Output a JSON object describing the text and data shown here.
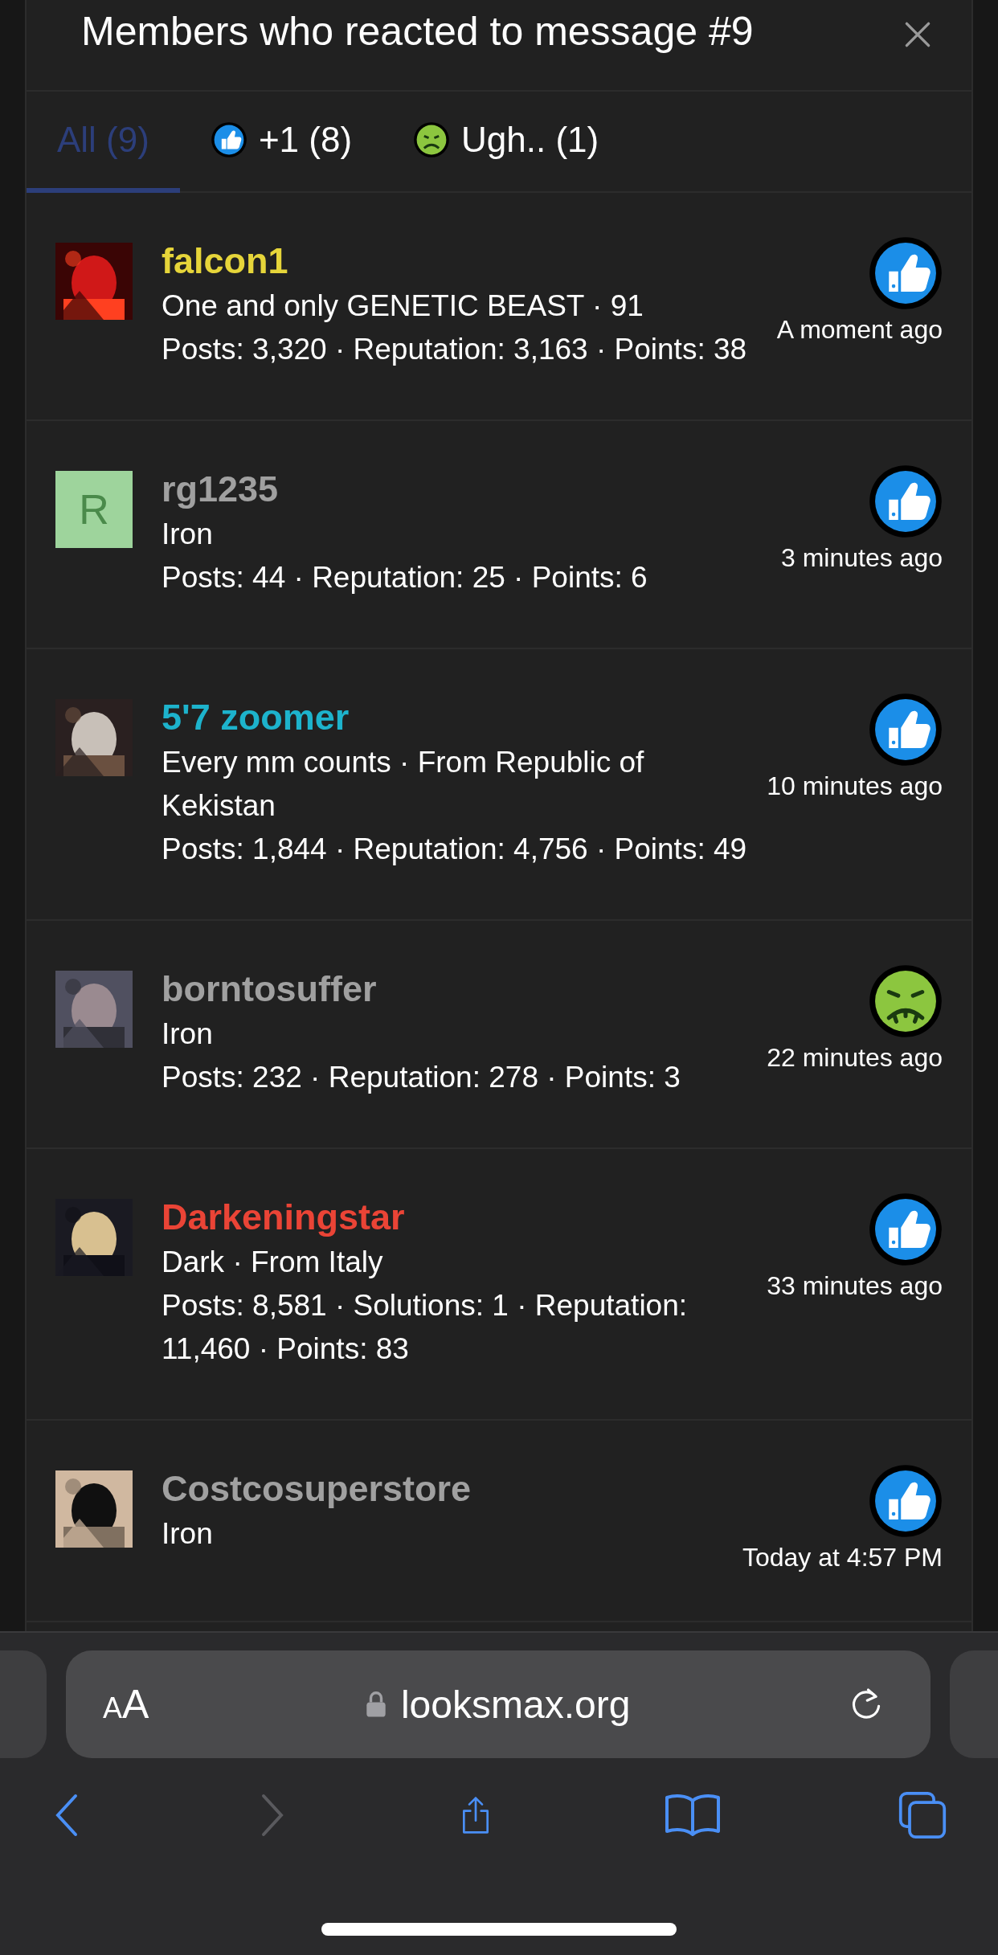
{
  "dialog": {
    "title": "Members who reacted to message #9"
  },
  "tabs": [
    {
      "label": "All (9)",
      "kind": "all",
      "selected": true
    },
    {
      "label": "+1 (8)",
      "kind": "like",
      "selected": false
    },
    {
      "label": "Ugh.. (1)",
      "kind": "ugh",
      "selected": false
    }
  ],
  "members": [
    {
      "name": "falcon1",
      "color": "#e6d53a",
      "details": "One and only GENETIC BEAST · 91",
      "stats": "Posts: 3,320 · Reputation: 3,163 · Points: 38",
      "reaction": {
        "kind": "like"
      },
      "time": "A moment ago"
    },
    {
      "name": "rg1235",
      "color": "#a0a0a0",
      "avatar": {
        "kind": "letter",
        "letter": "R"
      },
      "details": "Iron",
      "stats": "Posts: 44 · Reputation: 25 · Points: 6",
      "reaction": {
        "kind": "like"
      },
      "time": "3 minutes ago"
    },
    {
      "name": "5'7 zoomer",
      "color": "#1db3cc",
      "details": "Every mm counts · From Republic of Kekistan",
      "stats": "Posts: 1,844 · Reputation: 4,756 · Points: 49",
      "reaction": {
        "kind": "like"
      },
      "time": "10 minutes ago"
    },
    {
      "name": "borntosuffer",
      "color": "#a0a0a0",
      "details": "Iron",
      "stats": "Posts: 232 · Reputation: 278 · Points: 3",
      "reaction": {
        "kind": "ugh"
      },
      "time": "22 minutes ago"
    },
    {
      "name": "Darkeningstar",
      "color": "#ea4436",
      "details": "Dark · From Italy",
      "stats": "Posts: 8,581 · Solutions: 1 · Reputation: 11,460 · Points: 83",
      "reaction": {
        "kind": "like"
      },
      "time": "33 minutes ago"
    },
    {
      "name": "Costcosuperstore",
      "color": "#a0a0a0",
      "details": "Iron",
      "reaction": {
        "kind": "like"
      },
      "time": "Today at 4:57 PM"
    }
  ],
  "browser": {
    "reader_button": {
      "small": "A",
      "large": "A"
    },
    "url": "looksmax.org"
  }
}
